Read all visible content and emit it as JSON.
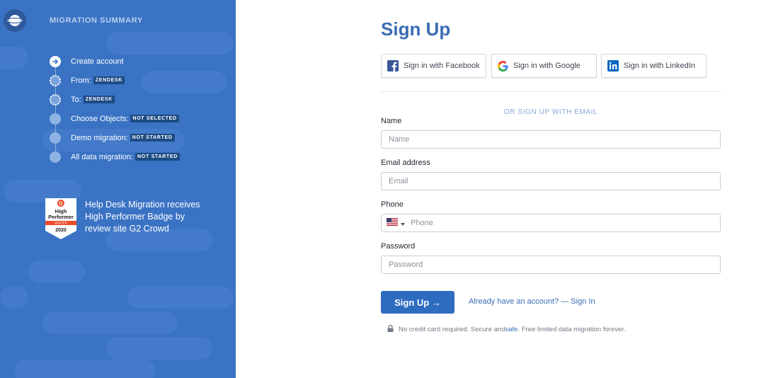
{
  "sidebar": {
    "summary_title": "MIGRATION SUMMARY",
    "steps": [
      {
        "label": "Create account",
        "tag": ""
      },
      {
        "label": "From:",
        "tag": "ZENDESK"
      },
      {
        "label": "To:",
        "tag": "ZENDESK"
      },
      {
        "label": "Choose Objects:",
        "tag": "NOT SELECTED"
      },
      {
        "label": "Demo migration:",
        "tag": "NOT STARTED"
      },
      {
        "label": "All data migration:",
        "tag": "NOT STARTED"
      }
    ],
    "badge": {
      "line1": "High",
      "line2": "Performer",
      "season": "WINTER",
      "year": "2020",
      "text": "Help Desk Migration receives High Performer Badge by review site G2 Crowd"
    }
  },
  "form": {
    "title": "Sign Up",
    "social": {
      "facebook": "Sign in with Facebook",
      "google": "Sign in with Google",
      "linkedin": "Sign in with LinkedIn"
    },
    "or_email": "OR SIGN UP WITH EMAIL",
    "name_label": "Name",
    "name_placeholder": "Name",
    "email_label": "Email address",
    "email_placeholder": "Email",
    "phone_label": "Phone",
    "phone_placeholder": "Phone",
    "password_label": "Password",
    "password_placeholder": "Password",
    "submit": "Sign Up →",
    "signin_link": "Already have an account? — Sign In",
    "note_before": "No credit card required. Secure and ",
    "note_safe": "safe",
    "note_after": ". Free limited data migration forever."
  },
  "colors": {
    "sidebar_bg": "#3a73c4",
    "accent": "#2e6cc0",
    "title": "#3a6db3",
    "tag_bg": "#1d4b84"
  },
  "icons": [
    "logo-icon",
    "arrow-right-icon",
    "facebook-icon",
    "google-icon",
    "linkedin-icon",
    "us-flag-icon",
    "caret-down-icon",
    "lock-icon"
  ]
}
